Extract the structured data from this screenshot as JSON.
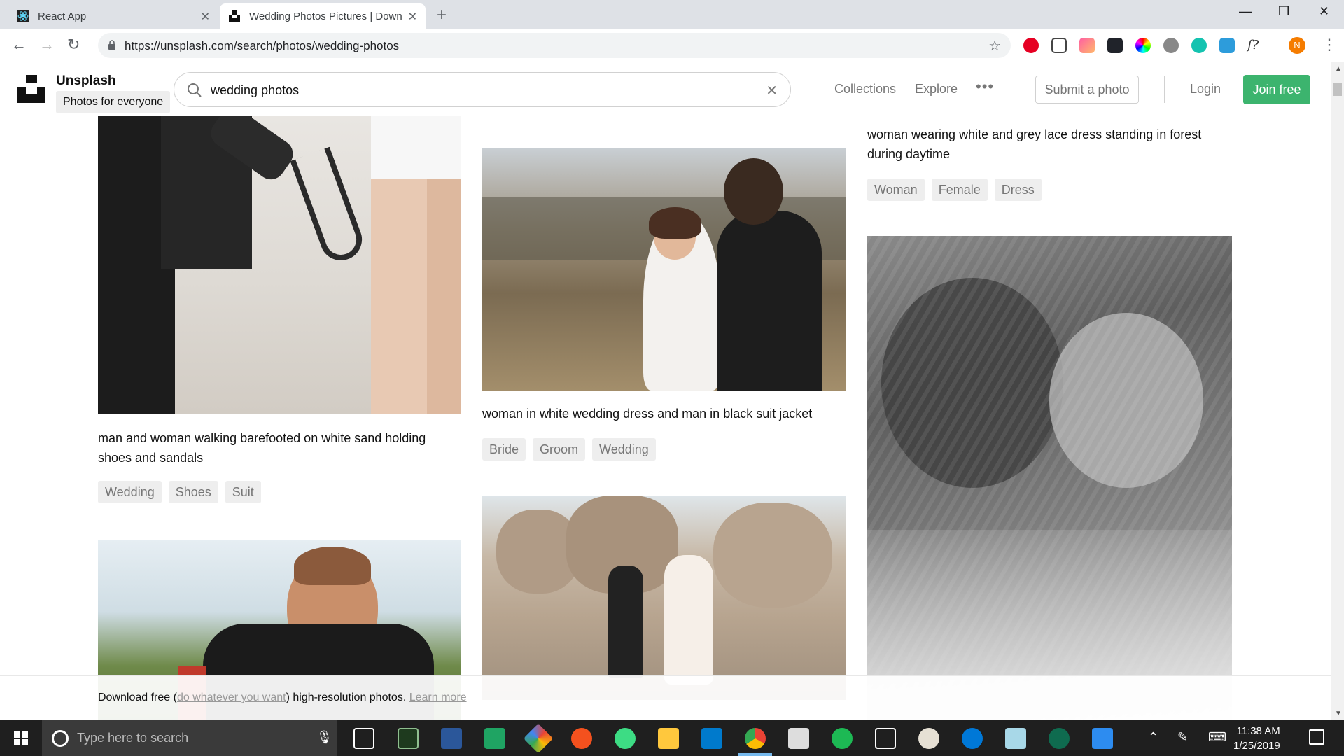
{
  "browser": {
    "tabs": [
      {
        "label": "React App"
      },
      {
        "label": "Wedding Photos Pictures | Download Free Images on Unsplash"
      }
    ],
    "new_tab": "+",
    "url": "https://unsplash.com/search/photos/wedding-photos",
    "profile_initial": "N"
  },
  "header": {
    "brand_name": "Unsplash",
    "brand_tagline": "Photos for everyone",
    "search_value": "wedding photos",
    "nav": {
      "collections": "Collections",
      "explore": "Explore",
      "more": "•••"
    },
    "submit_label": "Submit a photo",
    "login_label": "Login",
    "join_label": "Join free"
  },
  "photos": [
    {
      "caption": "man and woman walking barefooted on white sand holding shoes and sandals",
      "tags": [
        "Wedding",
        "Shoes",
        "Suit"
      ]
    },
    {
      "caption": "woman in white wedding dress and man in black suit jacket",
      "tags": [
        "Bride",
        "Groom",
        "Wedding"
      ]
    },
    {
      "caption": "woman wearing white and grey lace dress standing in forest during daytime",
      "tags": [
        "Woman",
        "Female",
        "Dress"
      ]
    }
  ],
  "banner": {
    "prefix": "Download free (",
    "link": "do whatever you want",
    "middle": ") high-resolution photos.",
    "learn_more": "Learn more"
  },
  "taskbar": {
    "search_placeholder": "Type here to search",
    "time": "11:38 AM",
    "date": "1/25/2019"
  },
  "colors": {
    "join_button": "#3cb46e",
    "tag_bg": "#eeeeee",
    "taskbar": "#1f1f1f"
  }
}
